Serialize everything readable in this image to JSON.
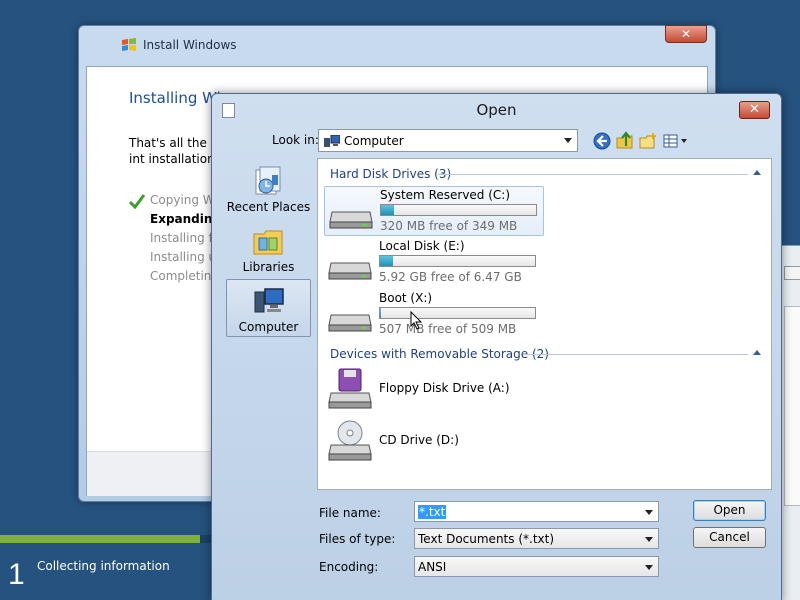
{
  "desktop": {
    "status_step_number": "1",
    "status_step_label": "Collecting information",
    "progress_fraction": 0.25
  },
  "setup": {
    "title": "Install Windows",
    "close_label": "✕",
    "heading": "Installing Wi",
    "description": "That's all the int installation.",
    "steps": [
      {
        "label": "Copying Wi",
        "state": "done"
      },
      {
        "label": "Expanding",
        "state": "active"
      },
      {
        "label": "Installing fe",
        "state": "pending"
      },
      {
        "label": "Installing u",
        "state": "pending"
      },
      {
        "label": "Completin",
        "state": "pending"
      }
    ]
  },
  "open_dialog": {
    "title": "Open",
    "close_label": "✕",
    "look_in_label": "Look in:",
    "look_in_value": "Computer",
    "toolbar": [
      "back-icon",
      "up-folder-icon",
      "new-folder-icon",
      "view-menu-icon"
    ],
    "places": [
      {
        "label": "Recent Places",
        "icon": "recent-places-icon"
      },
      {
        "label": "Libraries",
        "icon": "libraries-icon"
      },
      {
        "label": "Computer",
        "icon": "computer-icon",
        "selected": true
      }
    ],
    "groups": {
      "hard_disks": {
        "header": "Hard Disk Drives (3)",
        "drives": [
          {
            "name": "System Reserved (C:)",
            "free_text": "320 MB free of 349 MB",
            "used_fraction": 0.083
          },
          {
            "name": "Local Disk (E:)",
            "free_text": "5.92 GB free of 6.47 GB",
            "used_fraction": 0.085
          },
          {
            "name": "Boot (X:)",
            "free_text": "507 MB free of 509 MB",
            "used_fraction": 0.004
          }
        ]
      },
      "removable": {
        "header": "Devices with Removable Storage (2)",
        "drives": [
          {
            "name": "Floppy Disk Drive (A:)",
            "icon": "floppy-drive-icon"
          },
          {
            "name": "CD Drive (D:)",
            "icon": "cd-drive-icon"
          }
        ]
      }
    },
    "file_name_label": "File name:",
    "file_name_value": "*.txt",
    "files_of_type_label": "Files of type:",
    "files_of_type_value": "Text Documents (*.txt)",
    "encoding_label": "Encoding:",
    "encoding_value": "ANSI",
    "open_button": "Open",
    "cancel_button": "Cancel"
  },
  "colors": {
    "desktop": "#25527e",
    "progress": "#7fb03c",
    "drive_bar": "#1e93b8",
    "selection": "#3399ff"
  }
}
